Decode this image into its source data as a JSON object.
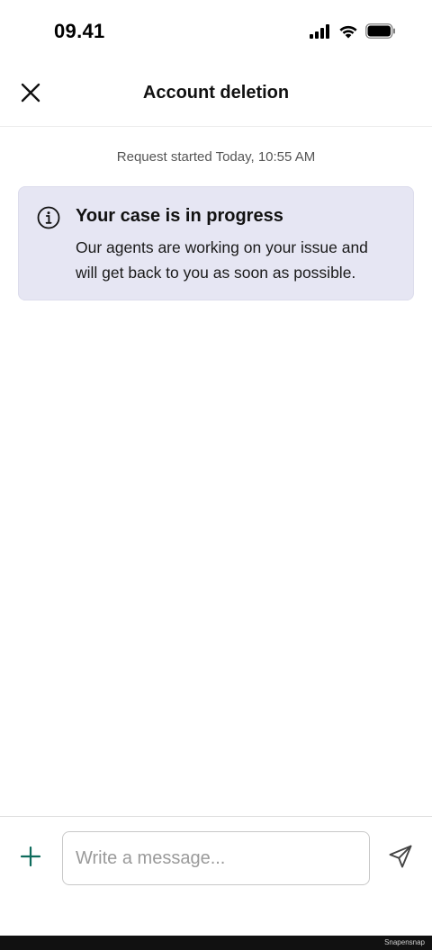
{
  "status_bar": {
    "time": "09.41",
    "icons": [
      "signal-icon",
      "wifi-icon",
      "battery-icon"
    ]
  },
  "header": {
    "title": "Account deletion",
    "close_icon": "close-icon"
  },
  "request": {
    "started_text": "Request started Today, 10:55 AM"
  },
  "info_card": {
    "icon": "info-icon",
    "title": "Your case is in progress",
    "body": "Our agents are working on your issue and will get back to you as soon as possible.",
    "background": "#e6e6f3"
  },
  "composer": {
    "add_icon": "plus-icon",
    "placeholder": "Write a message...",
    "value": "",
    "send_icon": "send-icon",
    "accent": "#0e6b5c"
  },
  "footer": {
    "watermark": "Snapensnap"
  }
}
